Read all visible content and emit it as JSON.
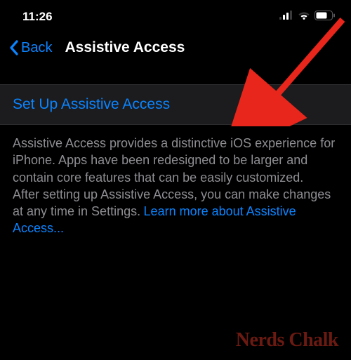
{
  "statusBar": {
    "time": "11:26"
  },
  "nav": {
    "backLabel": "Back",
    "title": "Assistive Access"
  },
  "main": {
    "setupLabel": "Set Up Assistive Access",
    "description1": "Assistive Access provides a distinctive iOS experience for iPhone. Apps have been redesigned to be larger and contain core features that can be easily customized.",
    "description2": "After setting up Assistive Access, you can make changes at any time in Settings.",
    "learnMoreLabel": "Learn more about Assistive Access..."
  },
  "watermark": {
    "text": "Nerds Chalk"
  }
}
